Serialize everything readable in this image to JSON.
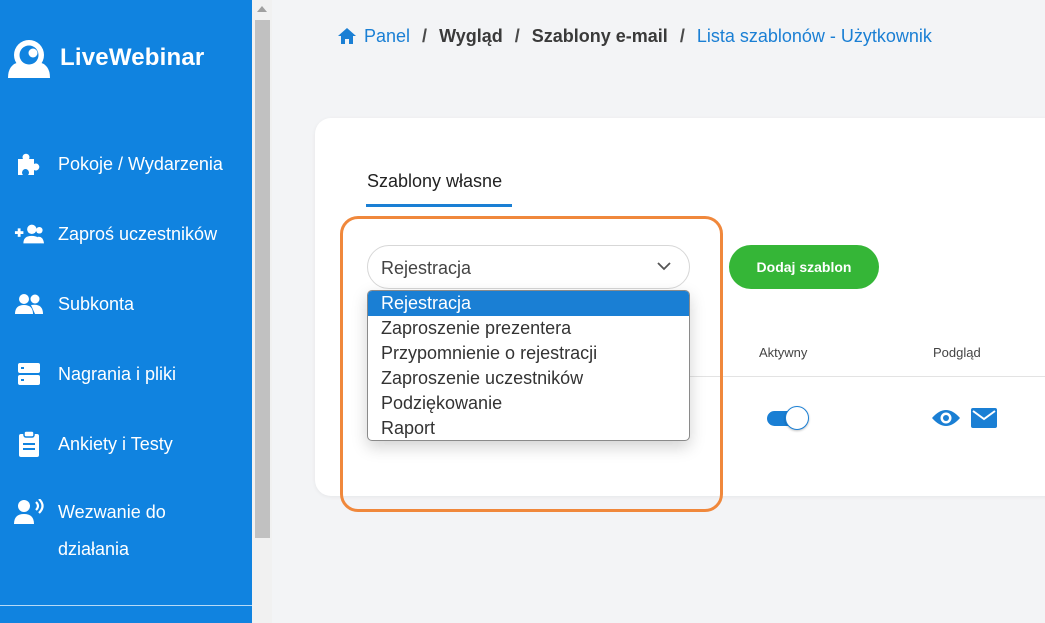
{
  "sidebar": {
    "brand": "LiveWebinar",
    "items": [
      {
        "label": "Pokoje / Wydarzenia",
        "icon": "puzzle-icon"
      },
      {
        "label": "Zaproś uczestników",
        "icon": "user-plus-icon"
      },
      {
        "label": "Subkonta",
        "icon": "users-icon"
      },
      {
        "label": "Nagrania i pliki",
        "icon": "server-icon"
      },
      {
        "label": "Ankiety i Testy",
        "icon": "clipboard-icon"
      },
      {
        "label_line1": "Wezwanie do",
        "label_line2": "działania",
        "icon": "user-voice-icon"
      }
    ]
  },
  "breadcrumb": {
    "home": "Panel",
    "sep": "/",
    "items": [
      "Wygląd",
      "Szablony e-mail"
    ],
    "current": "Lista szablonów - Użytkownik"
  },
  "card": {
    "tab_label": "Szablony własne",
    "select_value": "Rejestracja",
    "add_button": "Dodaj szablon",
    "columns": {
      "active": "Aktywny",
      "preview": "Podgląd"
    }
  },
  "dropdown": {
    "options": [
      "Rejestracja",
      "Zaproszenie prezentera",
      "Przypomnienie o rejestracji",
      "Zaproszenie uczestników",
      "Podziękowanie",
      "Raport"
    ],
    "selected_index": 0
  },
  "colors": {
    "sidebar": "#1083e0",
    "accent": "#1a7fd4",
    "button_green": "#35b637",
    "highlight": "#f0883c"
  }
}
